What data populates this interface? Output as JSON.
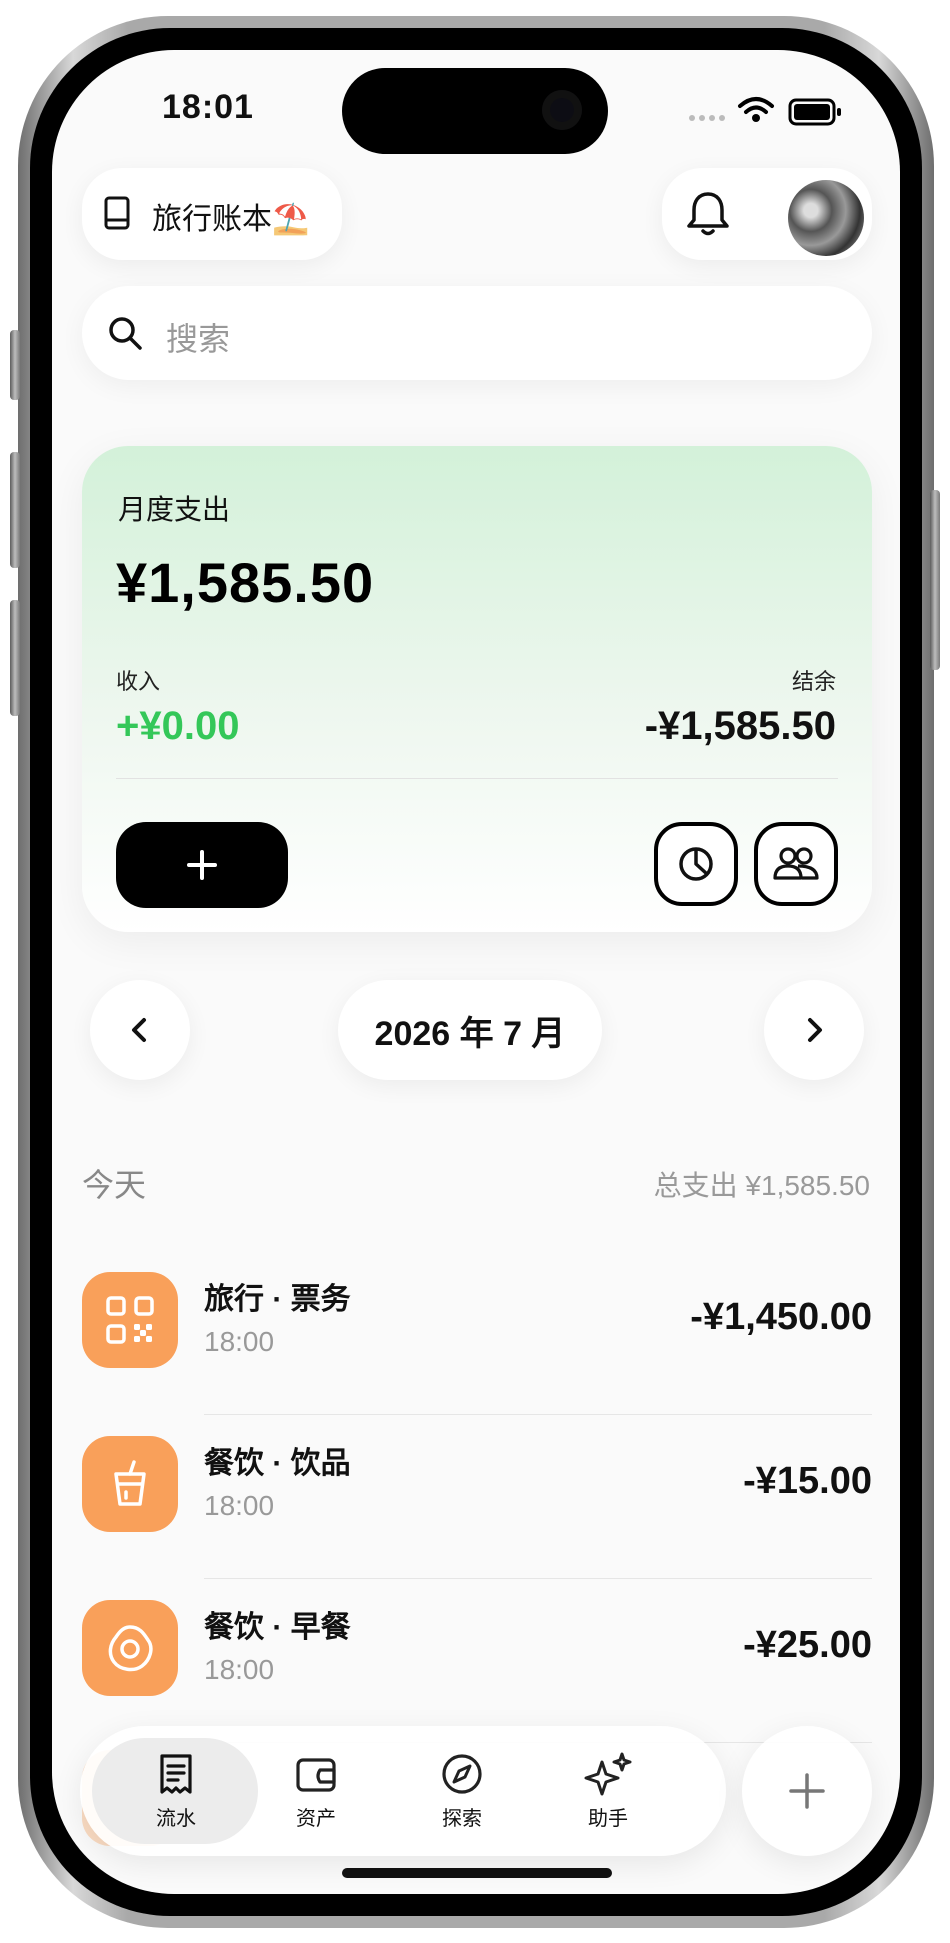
{
  "status_bar": {
    "time": "18:01"
  },
  "header": {
    "book_name": "旅行账本⛱️"
  },
  "search": {
    "placeholder": "搜索"
  },
  "summary": {
    "title": "月度支出",
    "amount": "¥1,585.50",
    "income_label": "收入",
    "income_value": "+¥0.00",
    "balance_label": "结余",
    "balance_value": "-¥1,585.50"
  },
  "month_nav": {
    "label": "2026 年 7 月"
  },
  "day_group": {
    "label": "今天",
    "total": "总支出 ¥1,585.50"
  },
  "transactions": [
    {
      "title": "旅行 · 票务",
      "time": "18:00",
      "amount": "-¥1,450.00",
      "icon": "qr-ticket-icon"
    },
    {
      "title": "餐饮 · 饮品",
      "time": "18:00",
      "amount": "-¥15.00",
      "icon": "drink-cup-icon"
    },
    {
      "title": "餐饮 · 早餐",
      "time": "18:00",
      "amount": "-¥25.00",
      "icon": "fried-egg-icon"
    }
  ],
  "tabbar": {
    "tabs": [
      {
        "label": "流水",
        "icon": "receipt-icon",
        "active": true
      },
      {
        "label": "资产",
        "icon": "wallet-icon",
        "active": false
      },
      {
        "label": "探索",
        "icon": "compass-icon",
        "active": false
      },
      {
        "label": "助手",
        "icon": "sparkle-icon",
        "active": false
      }
    ]
  },
  "colors": {
    "income": "#34c759",
    "category_orange": "#f9a05a",
    "card_green": "#d3f1d9"
  }
}
